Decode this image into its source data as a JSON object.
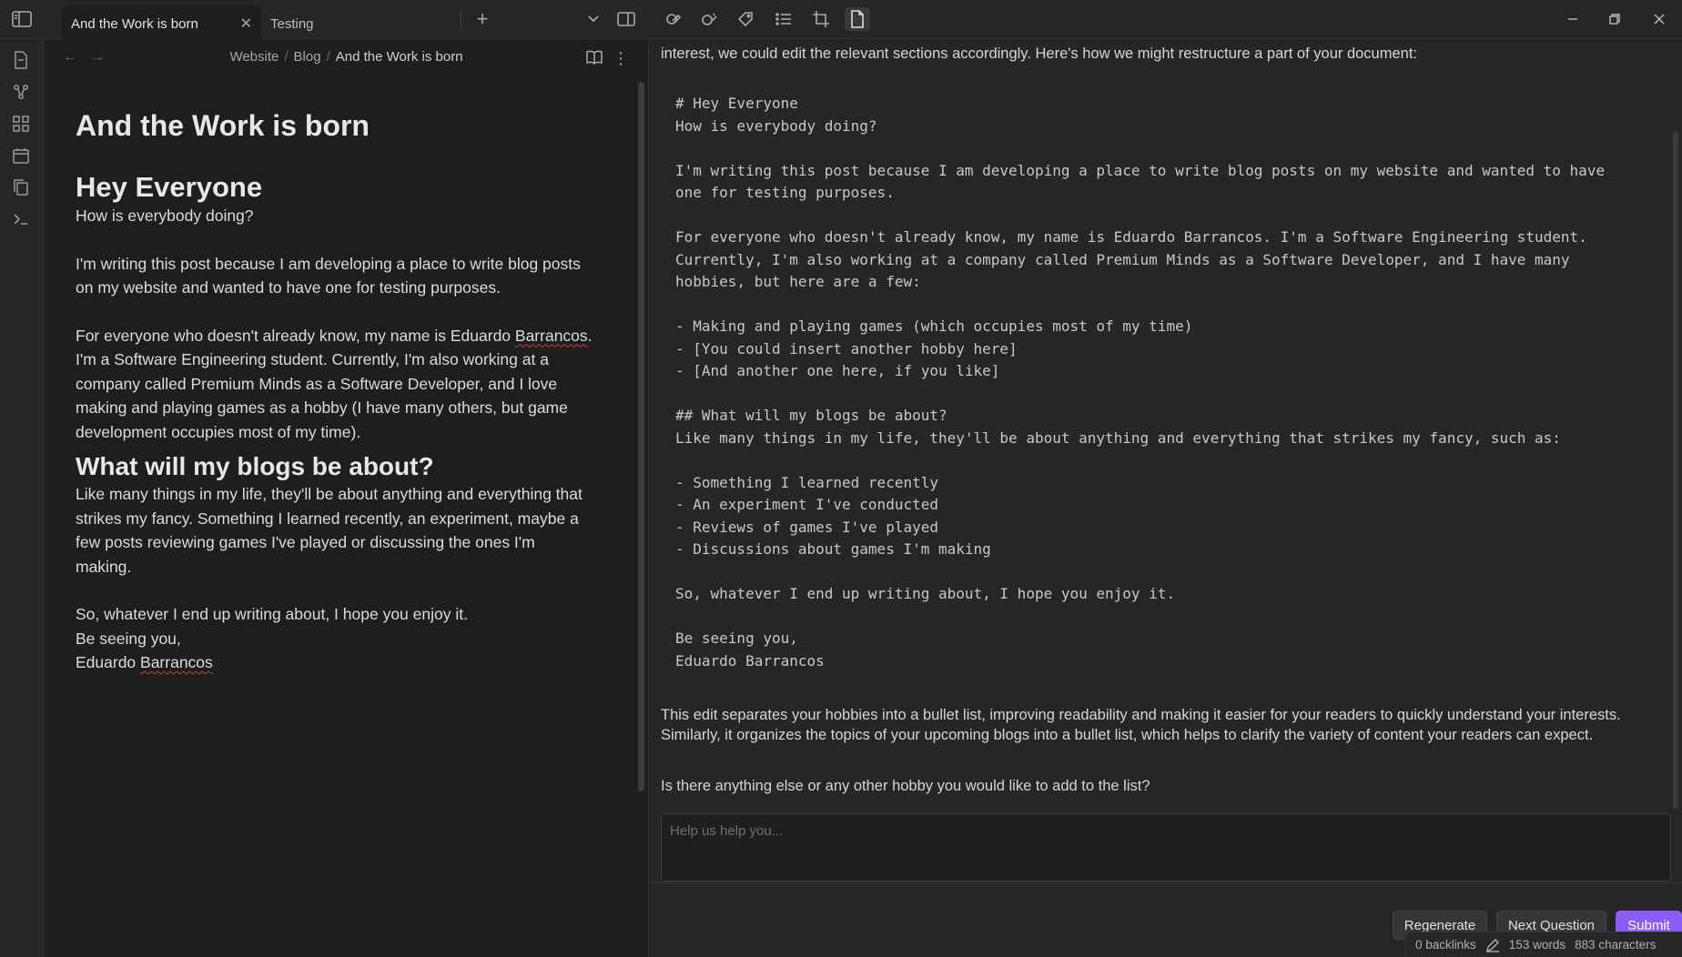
{
  "tabs": [
    {
      "label": "And the Work is born",
      "active": true
    },
    {
      "label": "Testing",
      "active": false
    }
  ],
  "breadcrumb": {
    "parts": [
      "Website",
      "Blog"
    ],
    "current": "And the Work is born"
  },
  "document": {
    "title": "And the Work is born",
    "h2": "Hey Everyone",
    "greeting": "How is everybody doing?",
    "p1": "I'm writing this post because I am developing a place to write blog posts on my website and wanted to have one for testing purposes.",
    "p2_a": "For everyone who doesn't already know, my name is Eduardo ",
    "p2_b": "Barrancos",
    "p2_c": ". I'm a Software Engineering student. Currently, I'm also working at a company called Premium Minds as a Software Developer, and I love making and playing games as a hobby (I have many others, but game development occupies most of my time).",
    "h3": "What will my blogs be about?",
    "p3": "Like many things in my life, they'll be about anything and everything that strikes my fancy. Something I learned recently, an experiment, maybe a few posts reviewing games I've played or discussing the ones I'm making.",
    "closing": "So, whatever I end up writing about, I hope you enjoy it.",
    "signoff": "Be seeing you,",
    "author_a": "Eduardo ",
    "author_b": "Barrancos"
  },
  "assistant": {
    "response_top": "interest, we could edit the relevant sections accordingly. Here's how we might restructure a part of your document:",
    "code": "# Hey Everyone\nHow is everybody doing?\n\nI'm writing this post because I am developing a place to write blog posts on my website and wanted to have\none for testing purposes.\n\nFor everyone who doesn't already know, my name is Eduardo Barrancos. I'm a Software Engineering student.\nCurrently, I'm also working at a company called Premium Minds as a Software Developer, and I have many\nhobbies, but here are a few:\n\n- Making and playing games (which occupies most of my time)\n- [You could insert another hobby here]\n- [And another one here, if you like]\n\n## What will my blogs be about?\nLike many things in my life, they'll be about anything and everything that strikes my fancy, such as:\n\n- Something I learned recently\n- An experiment I've conducted\n- Reviews of games I've played\n- Discussions about games I'm making\n\nSo, whatever I end up writing about, I hope you enjoy it.\n\nBe seeing you,\nEduardo Barrancos",
    "response_bottom": "This edit separates your hobbies into a bullet list, improving readability and making it easier for your readers to quickly understand your interests. Similarly, it organizes the topics of your upcoming blogs into a bullet list, which helps to clarify the variety of content your readers can expect.",
    "question": "Is there anything else or any other hobby you would like to add to the list?",
    "input_placeholder": "Help us help you...",
    "buttons": {
      "regenerate": "Regenerate",
      "next_question": "Next Question",
      "submit": "Submit"
    }
  },
  "status": {
    "backlinks": "0 backlinks",
    "words": "153 words",
    "characters": "883 characters"
  },
  "colors": {
    "accent": "#8b5cf6",
    "background": "#1e1e1e",
    "panel": "#262626"
  }
}
